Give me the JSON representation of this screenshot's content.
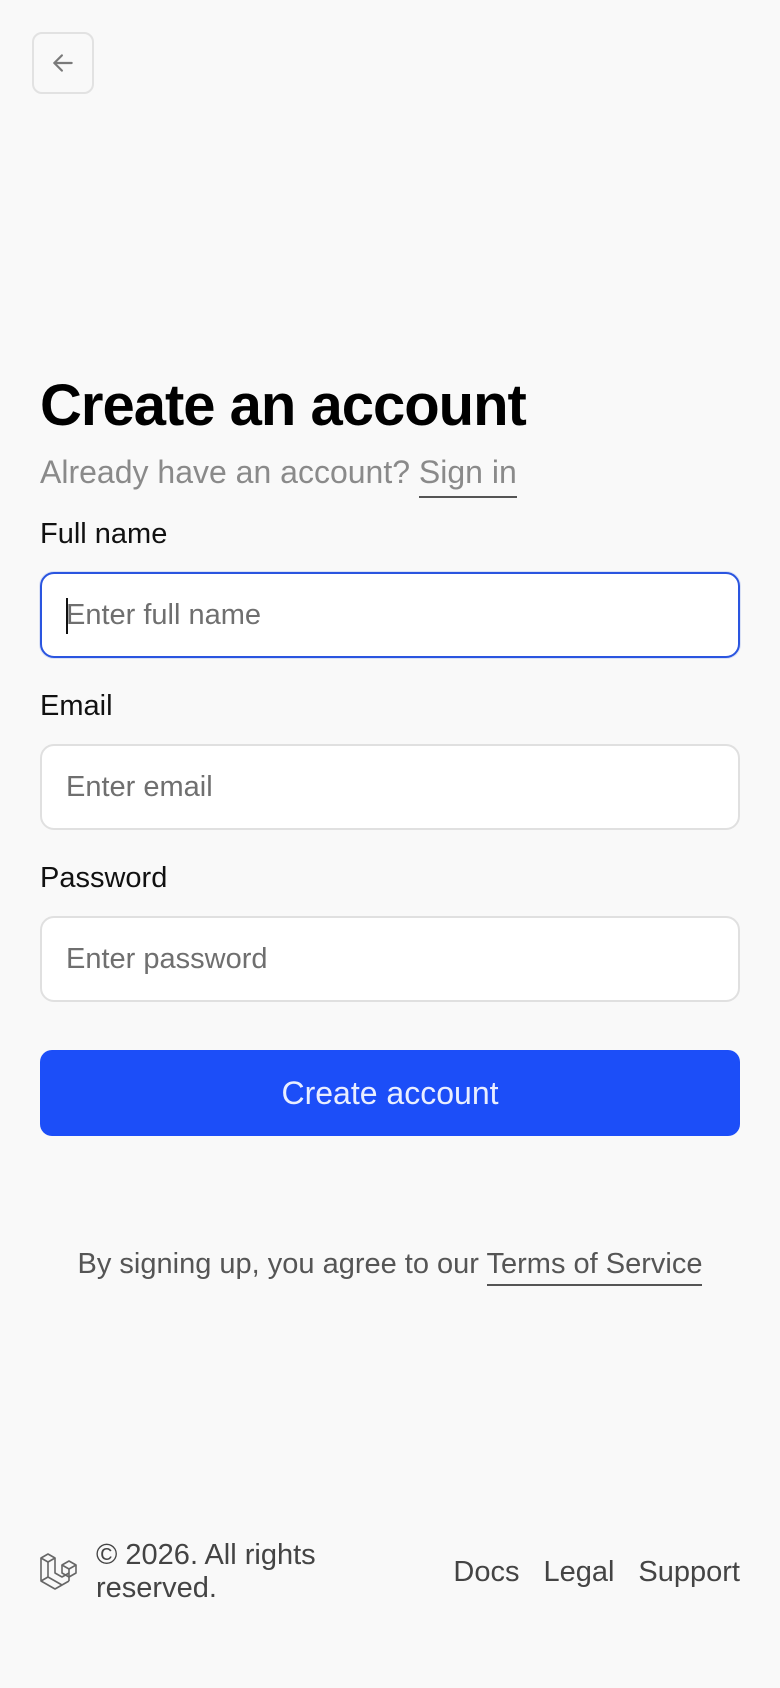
{
  "nav": {
    "back_icon": "arrow-left-icon"
  },
  "header": {
    "title": "Create an account",
    "subtitle_prefix": "Already have an account?",
    "signin_link": "Sign in"
  },
  "form": {
    "full_name": {
      "label": "Full name",
      "placeholder": "Enter full name",
      "value": ""
    },
    "email": {
      "label": "Email",
      "placeholder": "Enter email",
      "value": ""
    },
    "password": {
      "label": "Password",
      "placeholder": "Enter password",
      "value": ""
    },
    "submit_label": "Create account"
  },
  "terms": {
    "prefix": "By signing up, you agree to our",
    "link": "Terms of Service"
  },
  "footer": {
    "logo_icon": "laravel-logo-icon",
    "copyright": "© 2026. All rights reserved.",
    "links": [
      "Docs",
      "Legal",
      "Support"
    ]
  },
  "colors": {
    "primary": "#1c4ef8",
    "focus_border": "#2a55e0",
    "background": "#f9f9f9",
    "muted_text": "#8a8a8a"
  }
}
